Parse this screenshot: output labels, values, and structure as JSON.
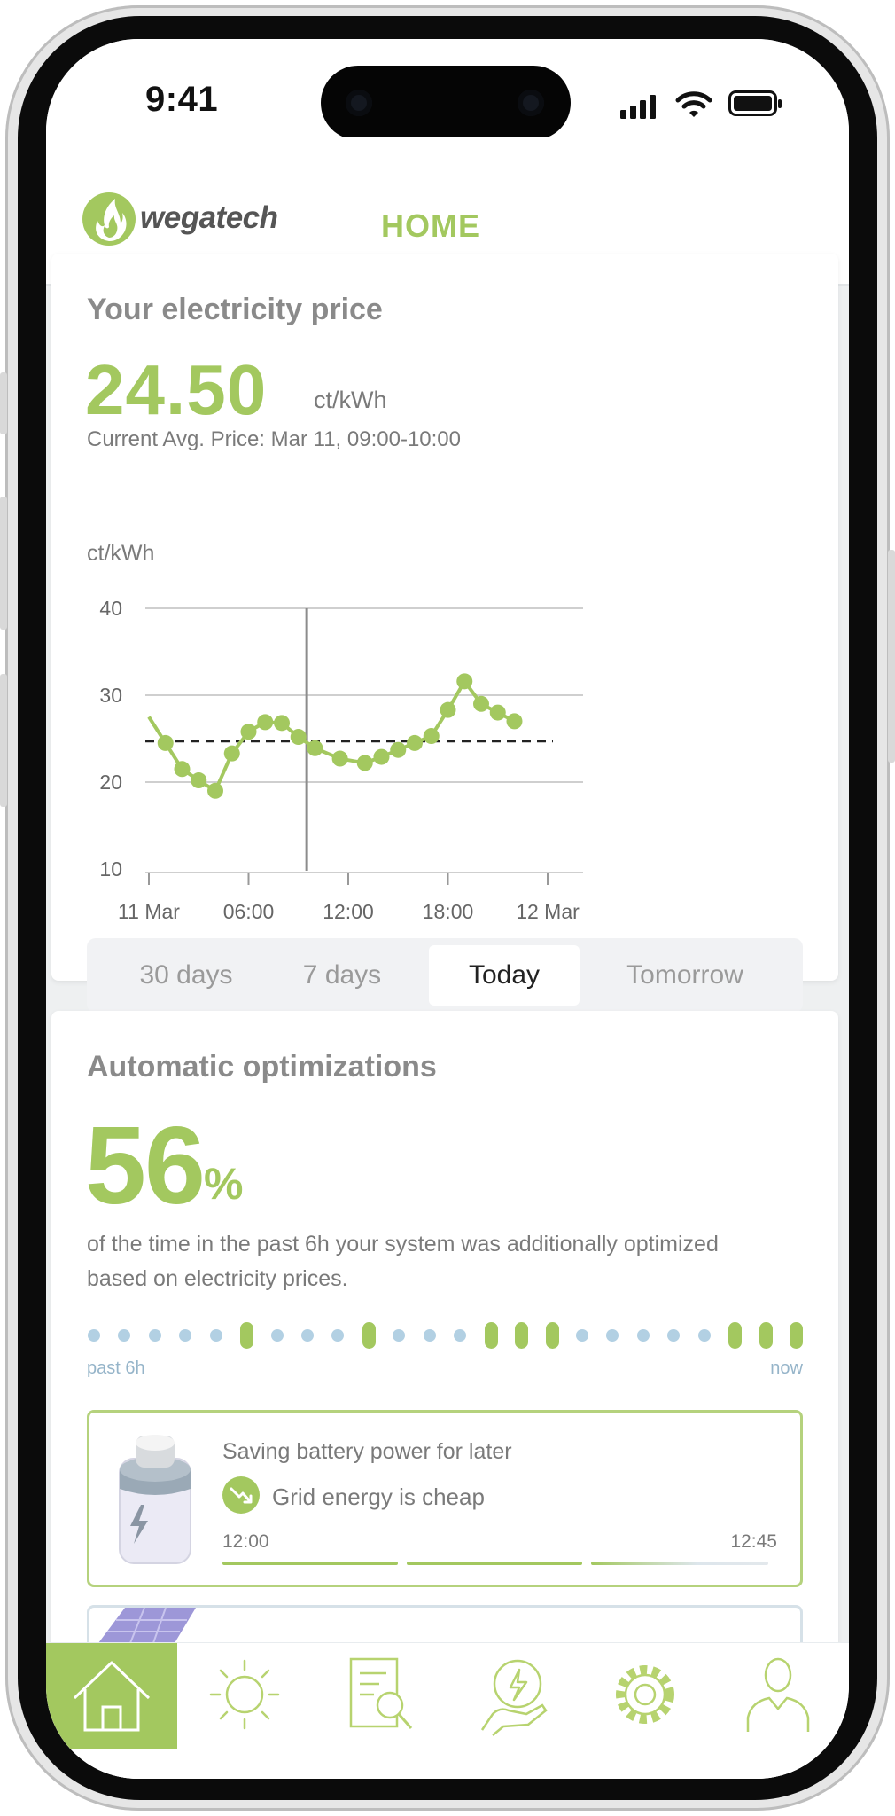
{
  "status_bar": {
    "time": "9:41"
  },
  "header": {
    "brand": "wegatech",
    "title": "HOME"
  },
  "price_card": {
    "title": "Your electricity price",
    "price": "24.50",
    "unit": "ct/kWh",
    "subtitle": "Current Avg. Price: Mar 11, 09:00-10:00",
    "y_unit": "ct/kWh",
    "tabs": [
      "30 days",
      "7 days",
      "Today",
      "Tomorrow"
    ],
    "active_tab": "Today"
  },
  "chart_data": {
    "type": "line",
    "ylabel": "ct/kWh",
    "ylim": [
      10,
      40
    ],
    "yticks": [
      40,
      30,
      20,
      10
    ],
    "xticks": [
      "11 Mar",
      "06:00",
      "12:00",
      "18:00",
      "12 Mar"
    ],
    "x_hours": [
      0,
      1,
      2,
      3,
      4,
      5,
      6,
      7,
      8,
      9,
      10,
      11.5,
      13,
      14,
      15,
      16,
      17,
      18,
      19,
      20,
      21,
      22,
      23,
      24
    ],
    "values": [
      27.5,
      24.5,
      21.5,
      20.2,
      19.0,
      23.3,
      25.8,
      26.9,
      26.8,
      25.2,
      23.9,
      22.7,
      22.2,
      22.9,
      23.7,
      24.5,
      25.3,
      28.3,
      31.6,
      29.0,
      28.0,
      27.0
    ],
    "average": 24.7,
    "current_hour": 9.5,
    "grid": true
  },
  "optim_card": {
    "title": "Automatic optimizations",
    "percent": "56",
    "percent_sign": "%",
    "description": "of the time in the past 6h your system was additionally optimized based on electricity prices.",
    "timeline": [
      0,
      0,
      0,
      0,
      0,
      1,
      0,
      0,
      0,
      1,
      0,
      0,
      0,
      1,
      1,
      1,
      0,
      0,
      0,
      0,
      0,
      1,
      1,
      1
    ],
    "past_label": "past 6h",
    "now_label": "now",
    "item": {
      "title": "Saving battery power for later",
      "reason": "Grid energy is cheap",
      "start": "12:00",
      "end": "12:45"
    }
  },
  "bottom_nav": {
    "items": [
      "home-icon",
      "sun-icon",
      "report-search-icon",
      "energy-hand-icon",
      "gear-icon",
      "user-icon"
    ],
    "active": 0
  },
  "colors": {
    "accent": "#a3c85f",
    "muted": "#7a7a7a",
    "dot": "#b2d0e3"
  }
}
